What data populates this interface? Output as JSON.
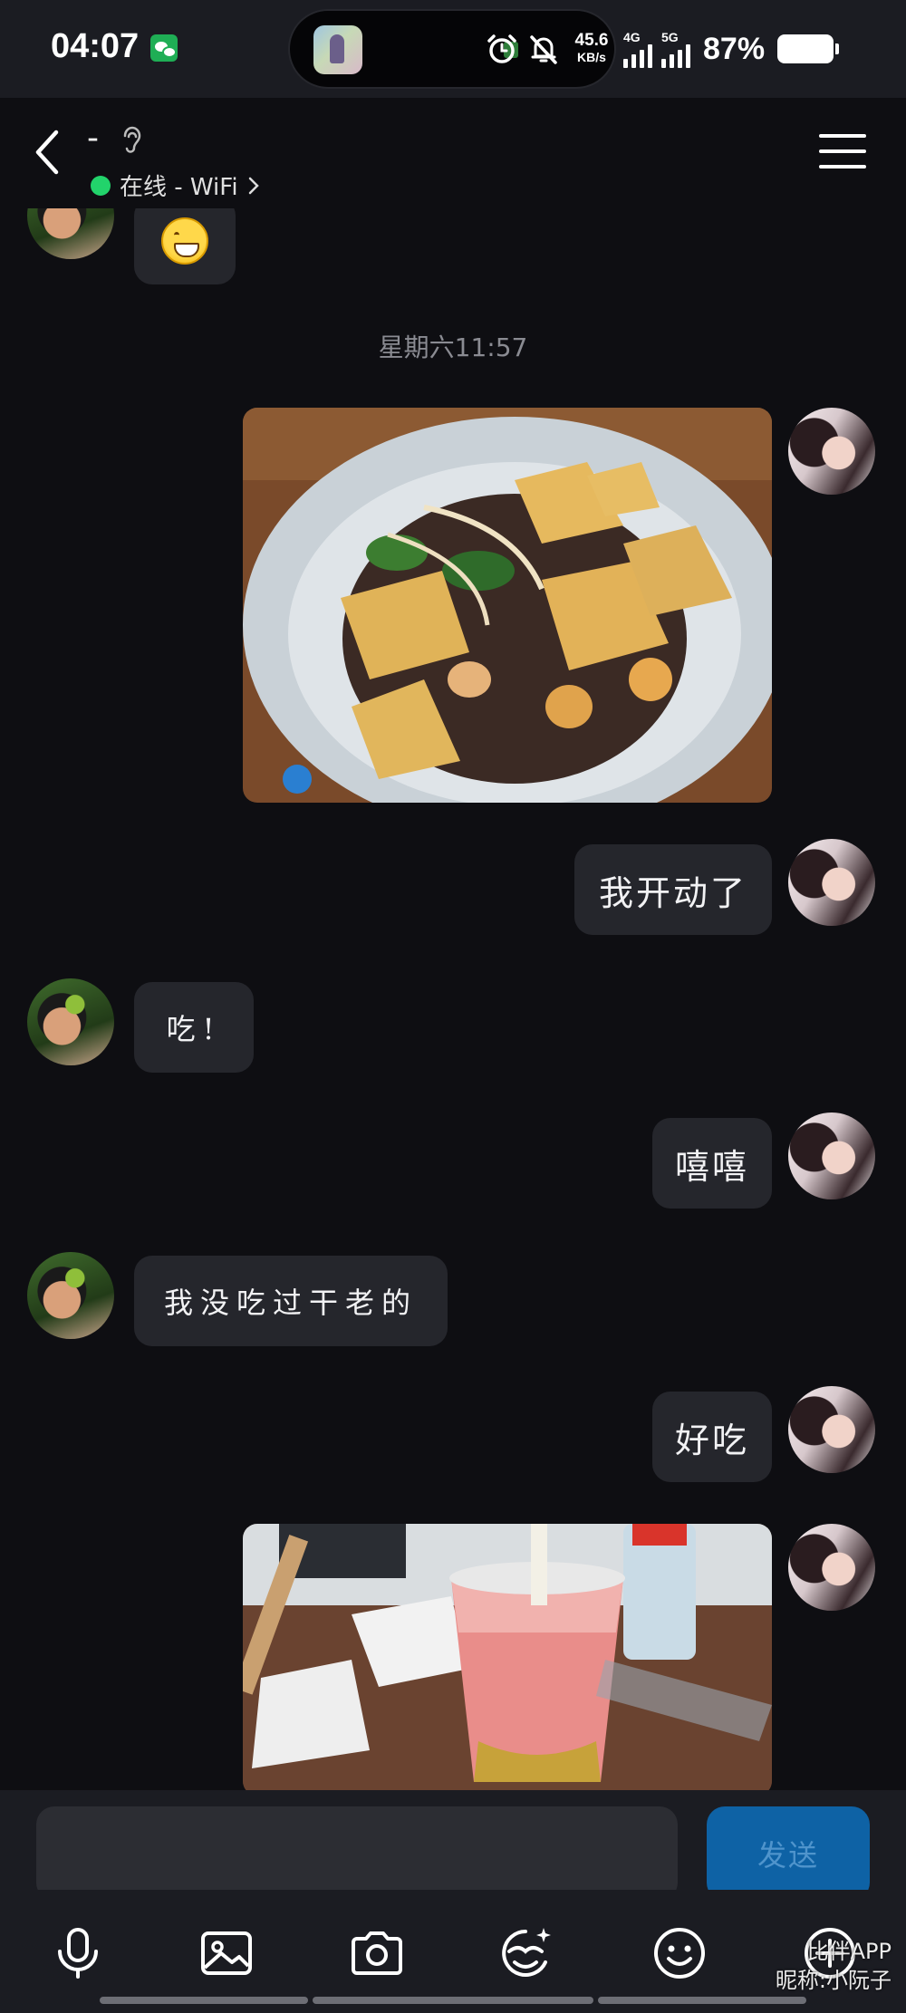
{
  "status_bar": {
    "time": "04:07",
    "net_speed_value": "45.6",
    "net_speed_unit": "KB/s",
    "signal_1_tag": "4G",
    "signal_2_tag": "5G",
    "battery": "87%",
    "icons": [
      "wechat-icon",
      "alarm-icon",
      "mute-icon",
      "signal-icon",
      "battery-icon"
    ]
  },
  "header": {
    "contact_name": "-",
    "status": "在线 - WiFi",
    "icons": [
      "back-icon",
      "ear-icon",
      "chevron-right-icon",
      "menu-icon"
    ]
  },
  "messages": [
    {
      "side": "left",
      "type": "emoji",
      "content": "grinning-face"
    },
    {
      "type": "timestamp",
      "text": "星期六11:57"
    },
    {
      "side": "right",
      "type": "image",
      "content": "bowl of noodles with fried wonton crisps"
    },
    {
      "side": "right",
      "type": "text",
      "text": "我开动了"
    },
    {
      "side": "left",
      "type": "text",
      "text": "吃!"
    },
    {
      "side": "right",
      "type": "text",
      "text": "嘻嘻"
    },
    {
      "side": "left",
      "type": "text",
      "text": "我没吃过干老的"
    },
    {
      "side": "right",
      "type": "text",
      "text": "好吃"
    },
    {
      "side": "right",
      "type": "image",
      "content": "pink fruit tea cup on desk"
    }
  ],
  "input": {
    "value": "",
    "placeholder": "",
    "send_label": "发送"
  },
  "toolbar": {
    "icons": [
      "microphone-icon",
      "image-icon",
      "camera-icon",
      "sticker-icon",
      "emoji-icon",
      "plus-icon"
    ]
  },
  "watermark": {
    "line1": "比伴APP",
    "line2": "昵称:小阮子"
  },
  "colors": {
    "background": "#0e0e12",
    "bubble": "#25262c",
    "online": "#22d36b",
    "send_button": "#0e62a5"
  }
}
